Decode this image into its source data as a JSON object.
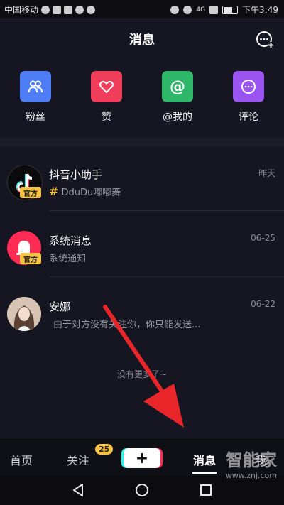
{
  "status_bar": {
    "carrier": "中国移动",
    "time": "下午3:49",
    "network": "4G"
  },
  "header": {
    "title": "消息"
  },
  "shortcuts": [
    {
      "label": "粉丝",
      "color": "#4f7df5",
      "icon": "fans-icon"
    },
    {
      "label": "赞",
      "color": "#f03e5a",
      "icon": "heart-icon"
    },
    {
      "label": "@我的",
      "color": "#2fb86a",
      "icon": "at-icon"
    },
    {
      "label": "评论",
      "color": "#9a55f0",
      "icon": "comment-icon"
    }
  ],
  "messages": [
    {
      "name": "抖音小助手",
      "subtitle": "DduDu嘟嘟舞",
      "time": "昨天",
      "badge": "官方",
      "hash": "#"
    },
    {
      "name": "系统消息",
      "subtitle": "系统通知",
      "time": "06-25",
      "badge": "官方"
    },
    {
      "name": "安娜",
      "subtitle": "由于对方没有关注你，你只能发送...",
      "time": "06-22"
    }
  ],
  "no_more": "没有更多了~",
  "bottom_nav": {
    "home": "首页",
    "follow": "关注",
    "follow_count": "25",
    "plus": "+",
    "messages": "消息",
    "me": "我"
  },
  "watermark": {
    "brand": "智能家",
    "url": "www.znj.com"
  },
  "colors": {
    "background": "#161622",
    "badge": "#f6c344",
    "arrow": "#e8262a"
  }
}
